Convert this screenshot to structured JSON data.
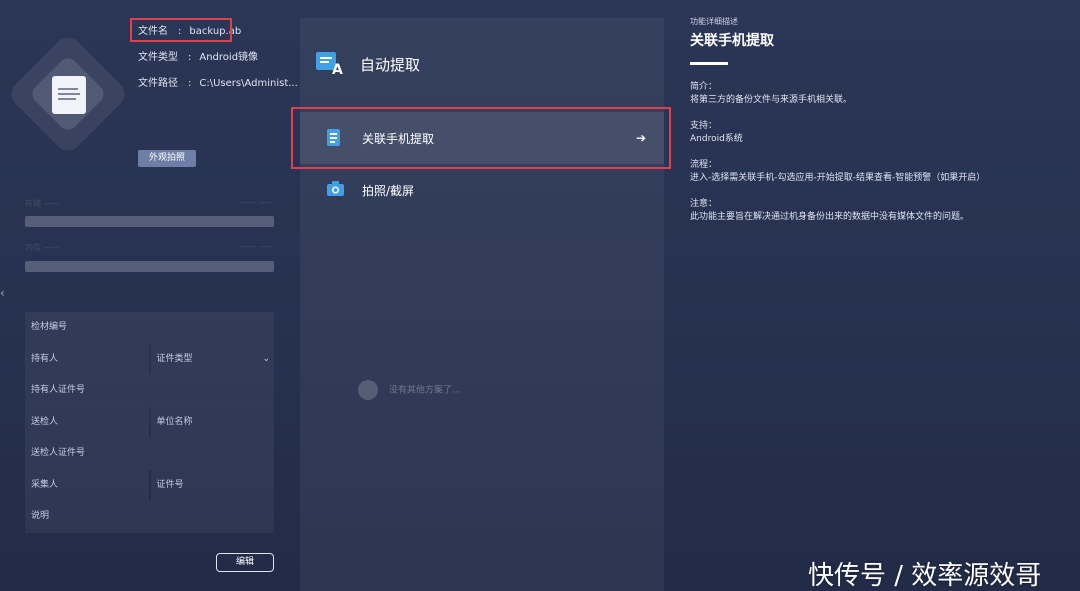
{
  "file_info": {
    "name_label": "文件名",
    "name_value": "backup.ab",
    "type_label": "文件类型",
    "type_value": "Android镜像",
    "path_label": "文件路径",
    "path_value": "C:\\Users\\Administ...",
    "separator": ":"
  },
  "appearance_button": "外观拍照",
  "progress_labels": {
    "row1_left": "存储 ——",
    "row1_right": "—— ——",
    "row2_left": "内存 ——",
    "row2_right": "—— ——"
  },
  "form": {
    "evidence_no": "检材编号",
    "holder": "持有人",
    "id_type": "证件类型",
    "holder_id": "持有人证件号",
    "submitter": "送检人",
    "org_name": "单位名称",
    "submitter_id": "送检人证件号",
    "collector": "采集人",
    "id_no": "证件号",
    "description": "说明"
  },
  "edit_button": "编辑",
  "middle": {
    "title": "自动提取",
    "options": [
      {
        "label": "关联手机提取",
        "icon": "phone-link-icon",
        "arrow": "➔"
      },
      {
        "label": "拍照/截屏",
        "icon": "camera-icon"
      }
    ],
    "empty_text": "没有其他方案了..."
  },
  "right": {
    "subtitle": "功能详细描述",
    "title": "关联手机提取",
    "sections": [
      {
        "heading": "简介：",
        "body": "将第三方的备份文件与来源手机相关联。"
      },
      {
        "heading": "支持：",
        "body": "Android系统"
      },
      {
        "heading": "流程：",
        "body": "进入-选择需关联手机-勾选应用-开始提取-结果查看-智能预警（如果开启）"
      },
      {
        "heading": "注意：",
        "body": "此功能主要旨在解决通过机身备份出来的数据中没有媒体文件的问题。"
      }
    ]
  },
  "watermark": "快传号 / 效率源效哥",
  "colors": {
    "background": "#2b3656",
    "highlight_red": "#e0404a",
    "accent_blue": "#3fa0e8"
  }
}
